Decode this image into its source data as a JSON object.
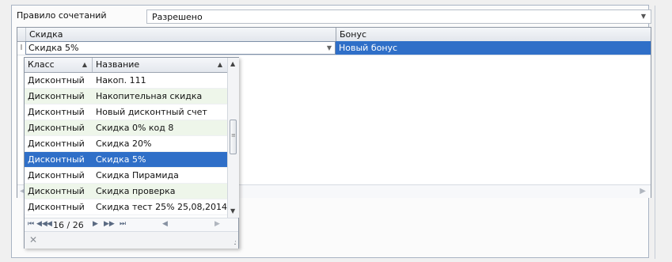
{
  "rule": {
    "label": "Правило сочетаний",
    "value": "Разрешено"
  },
  "grid": {
    "columns": {
      "discount": "Скидка",
      "bonus": "Бонус"
    },
    "row": {
      "discount": "Скидка 5%",
      "bonus": "Новый бонус"
    }
  },
  "lookup": {
    "columns": {
      "class": "Класс",
      "name": "Название"
    },
    "rows": [
      {
        "class": "Дисконтный",
        "name": "Накоп. 111"
      },
      {
        "class": "Дисконтный",
        "name": "Накопительная скидка"
      },
      {
        "class": "Дисконтный",
        "name": "Новый дисконтный счет"
      },
      {
        "class": "Дисконтный",
        "name": "Скидка 0% код 8"
      },
      {
        "class": "Дисконтный",
        "name": "Скидка 20%"
      },
      {
        "class": "Дисконтный",
        "name": "Скидка 5%"
      },
      {
        "class": "Дисконтный",
        "name": "Скидка Пирамида"
      },
      {
        "class": "Дисконтный",
        "name": "Скидка проверка"
      },
      {
        "class": "Дисконтный",
        "name": "Скидка тест 25% 25,08,2014"
      }
    ],
    "selected_index": 5,
    "navigator": {
      "counter": "16 / 26"
    }
  },
  "colors": {
    "selection": "#2f6fc8",
    "alt_row": "#eef6ea"
  }
}
